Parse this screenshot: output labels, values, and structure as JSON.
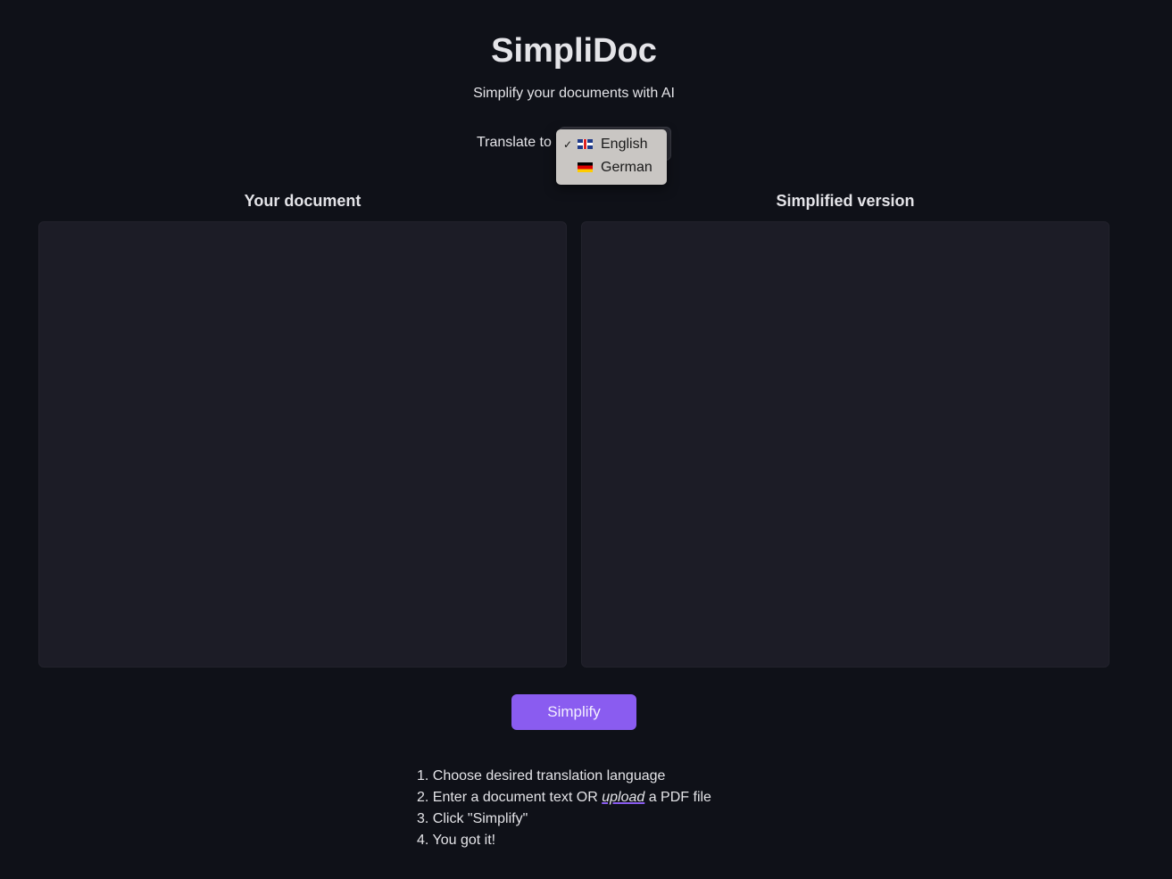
{
  "header": {
    "title": "SimpliDoc",
    "subtitle": "Simplify your documents with AI"
  },
  "translate": {
    "label": "Translate to",
    "selected": "English",
    "options": [
      {
        "label": "English",
        "flag": "uk-flag-icon",
        "checked": true
      },
      {
        "label": "German",
        "flag": "germany-flag-icon",
        "checked": false
      }
    ],
    "check_mark": "✓"
  },
  "panels": {
    "input_label": "Your document",
    "input_value": "",
    "output_label": "Simplified version",
    "output_value": ""
  },
  "actions": {
    "simplify_label": "Simplify"
  },
  "instructions": {
    "step1": "1. Choose desired translation language",
    "step2_prefix": "2. Enter a document text OR ",
    "step2_link": "upload",
    "step2_suffix": " a PDF file",
    "step3": "3. Click \"Simplify\"",
    "step4": "4. You got it!"
  },
  "colors": {
    "background": "#0f1118",
    "panel": "#1c1c26",
    "accent": "#8a5cf0",
    "dropdown": "#c9c6c3"
  }
}
